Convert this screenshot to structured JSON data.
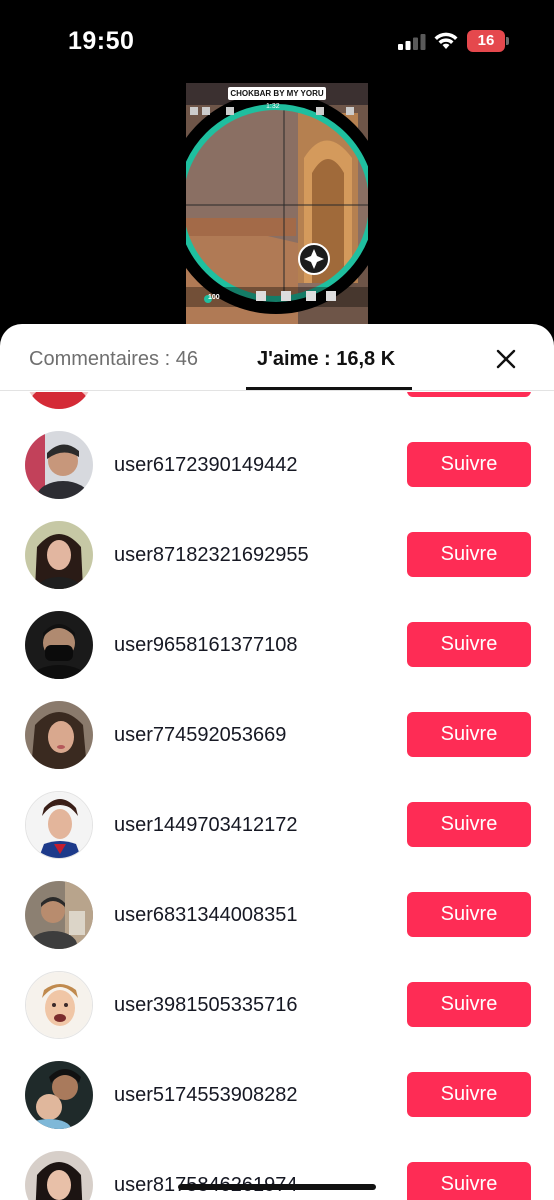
{
  "status_bar": {
    "time": "19:50",
    "battery_level": "16",
    "battery_color": "#e5484d"
  },
  "video": {
    "caption": "CHOKBAR BY MY YORU",
    "timer": "1:32",
    "hp": "100"
  },
  "sheet": {
    "tabs": {
      "comments_label": "Commentaires : 46",
      "likes_label": "J'aime : 16,8 K"
    },
    "follow_label": "Suivre",
    "accent_color": "#fe2c55",
    "users": [
      {
        "username": ""
      },
      {
        "username": "user6172390149442"
      },
      {
        "username": "user87182321692955"
      },
      {
        "username": "user9658161377108"
      },
      {
        "username": "user774592053669"
      },
      {
        "username": "user1449703412172"
      },
      {
        "username": "user6831344008351"
      },
      {
        "username": "user3981505335716"
      },
      {
        "username": "user5174553908282"
      },
      {
        "username": "user8175846261974"
      }
    ]
  }
}
